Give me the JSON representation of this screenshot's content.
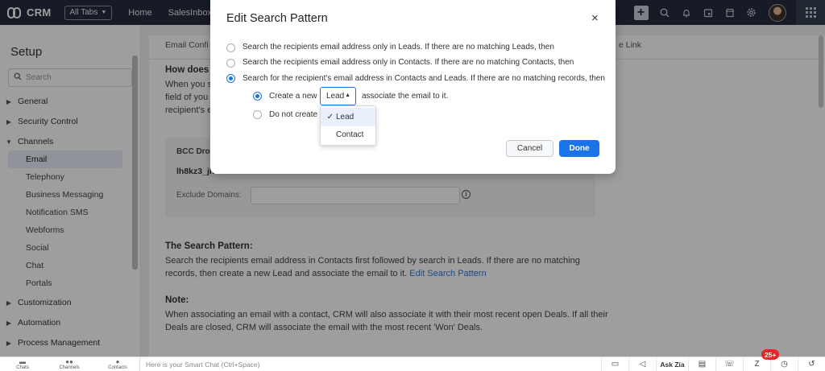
{
  "topbar": {
    "app_name": "CRM",
    "all_tabs": "All Tabs",
    "nav": [
      "Home",
      "SalesInbox"
    ]
  },
  "sidebar": {
    "title": "Setup",
    "search_placeholder": "Search",
    "sections": {
      "general": "General",
      "security": "Security Control",
      "channels": "Channels",
      "customization": "Customization",
      "automation": "Automation",
      "process": "Process Management"
    },
    "channels_items": [
      "Email",
      "Telephony",
      "Business Messaging",
      "Notification SMS",
      "Webforms",
      "Social",
      "Chat",
      "Portals"
    ],
    "active_item": "Email"
  },
  "main": {
    "tab_left": "Email Confi",
    "tab_right": "e Link",
    "how_title": "How does i",
    "how_text": "When you s field of you recipient's e",
    "bcc_label": "BCC Drop",
    "bcc_value": "lh8kz3_jh",
    "exclude_label": "Exclude Domains:",
    "search_pattern_title": "The Search Pattern:",
    "search_pattern_text": "Search the recipients email address in Contacts first followed by search in Leads. If there are no matching records, then create a new Lead and associate the email to it. ",
    "search_pattern_link": "Edit Search Pattern",
    "note_title": "Note:",
    "note_text": "When associating an email with a contact, CRM will also associate it with their most recent open Deals. If all their Deals are closed, CRM will associate the email with the most recent 'Won' Deals."
  },
  "modal": {
    "title": "Edit Search Pattern",
    "close": "×",
    "option1": "Search the recipients email address only in Leads. If there are no matching Leads, then",
    "option2": "Search the recipients email address only in Contacts. If there are no matching Contacts, then",
    "option3": "Search for the recipient's email address in Contacts and Leads. If there are no matching records, then",
    "create_new_label": "Create a new",
    "select_value": "Lead",
    "associate_text": "associate the email to it.",
    "do_not_create": "Do not create a",
    "selected_option": 3,
    "sub_selected": "create",
    "cancel": "Cancel",
    "done": "Done",
    "dropdown_options": [
      "Lead",
      "Contact"
    ],
    "dropdown_selected": "Lead"
  },
  "bottombar": {
    "tabs": [
      "Chats",
      "Channels",
      "Contacts"
    ],
    "smart_chat_placeholder": "Here is your Smart Chat (Ctrl+Space)",
    "ask_zia": "Ask Zia",
    "notification_count": "25+"
  },
  "colors": {
    "topbar": "#242d3c",
    "accent": "#1a73e8",
    "badge": "#e5252a"
  }
}
